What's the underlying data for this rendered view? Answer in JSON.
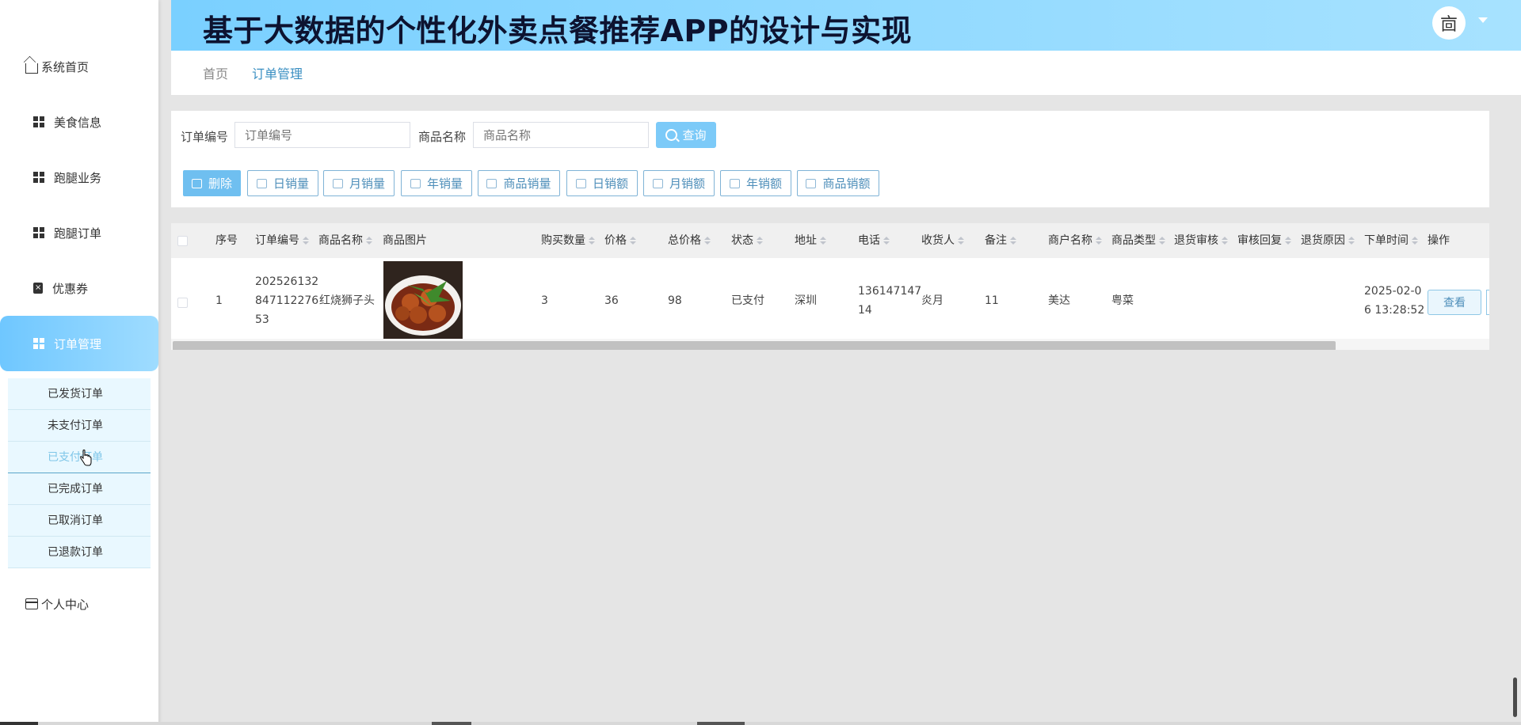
{
  "header": {
    "title": "基于大数据的个性化外卖点餐推荐APP的设计与实现",
    "avatar_glyph": "㐭"
  },
  "sidebar": {
    "items": [
      {
        "label": "系统首页",
        "icon": "home-icon"
      },
      {
        "label": "美食信息",
        "icon": "grid-icon"
      },
      {
        "label": "跑腿业务",
        "icon": "grid-icon"
      },
      {
        "label": "跑腿订单",
        "icon": "grid-icon"
      },
      {
        "label": "优惠券",
        "icon": "clipboard-icon"
      },
      {
        "label": "订单管理",
        "icon": "table-icon",
        "active": true
      },
      {
        "label": "个人中心",
        "icon": "card-icon"
      }
    ],
    "submenu": [
      {
        "label": "已发货订单"
      },
      {
        "label": "未支付订单"
      },
      {
        "label": "已支付订单",
        "active": true
      },
      {
        "label": "已完成订单"
      },
      {
        "label": "已取消订单"
      },
      {
        "label": "已退款订单"
      }
    ],
    "active_color": "#7fd0ff"
  },
  "breadcrumb": [
    "首页",
    "订单管理"
  ],
  "search": {
    "order_no_label": "订单编号",
    "order_no_placeholder": "订单编号",
    "product_label": "商品名称",
    "product_placeholder": "商品名称",
    "search_button": "查询"
  },
  "toolbar": [
    {
      "label": "删除",
      "primary": true
    },
    {
      "label": "日销量"
    },
    {
      "label": "月销量"
    },
    {
      "label": "年销量"
    },
    {
      "label": "商品销量"
    },
    {
      "label": "日销额"
    },
    {
      "label": "月销额"
    },
    {
      "label": "年销额"
    },
    {
      "label": "商品销额"
    }
  ],
  "table": {
    "headers": [
      "序号",
      "订单编号",
      "商品名称",
      "商品图片",
      "购买数量",
      "价格",
      "总价格",
      "状态",
      "地址",
      "电话",
      "收货人",
      "备注",
      "商户名称",
      "商品类型",
      "退货审核",
      "审核回复",
      "退货原因",
      "下单时间",
      "操作"
    ],
    "rows": [
      {
        "index": "1",
        "order_no_l1": "202526132",
        "order_no_l2": "847112276",
        "order_no_l3": "53",
        "product": "红烧狮子头",
        "quantity": "3",
        "price": "36",
        "total": "98",
        "status": "已支付",
        "address": "深圳",
        "phone_l1": "136147147",
        "phone_l2": "14",
        "receiver": "炎月",
        "remark": "11",
        "merchant": "美达",
        "category": "粤菜",
        "return_review": "",
        "review_reply": "",
        "return_reason": "",
        "time_l1": "2025-02-0",
        "time_l2": "6 13:28:52",
        "action": "查看"
      }
    ]
  }
}
